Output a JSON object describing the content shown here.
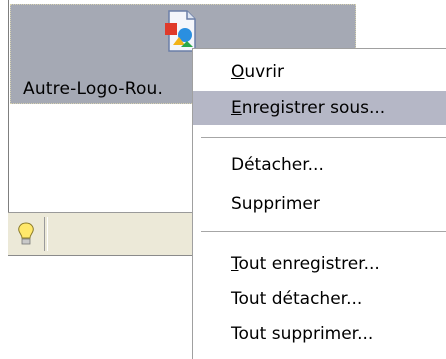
{
  "attachment": {
    "filename": "Autre-Logo-Rou."
  },
  "context_menu": {
    "items": [
      {
        "key": "ouvrir",
        "underline": "O",
        "rest": "uvrir"
      },
      {
        "key": "enregistrer",
        "underline": "E",
        "rest": "nregistrer sous...",
        "highlighted": true
      },
      {
        "key": "detacher",
        "text": "Détacher..."
      },
      {
        "key": "supprimer",
        "text": "Supprimer"
      },
      {
        "key": "tout-enregistrer",
        "underline": "T",
        "rest": "out enregistrer..."
      },
      {
        "key": "tout-detacher",
        "text": "Tout détacher..."
      },
      {
        "key": "tout-supprimer",
        "text": "Tout supprimer..."
      }
    ]
  },
  "colors": {
    "tile_bg": "#a5a9b4",
    "highlight": "#b5b7c6",
    "statusbar": "#ece9d8"
  },
  "icons": [
    "file-image-icon",
    "lightbulb-icon"
  ]
}
